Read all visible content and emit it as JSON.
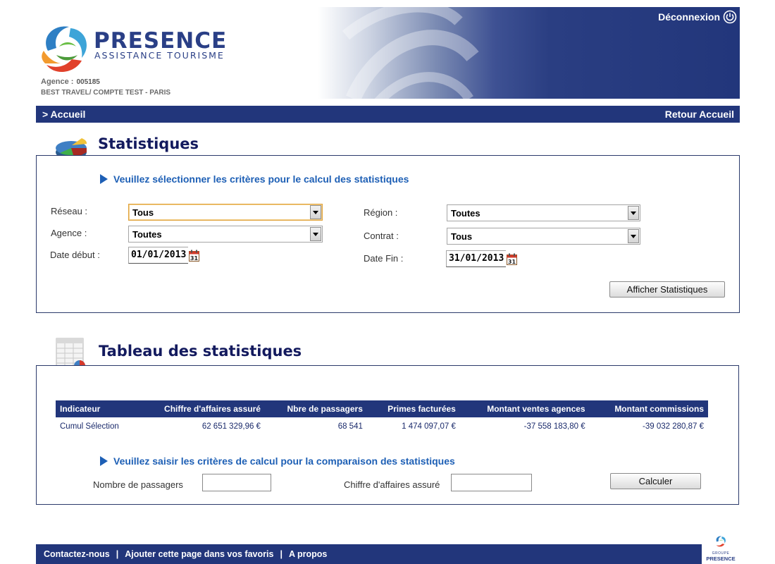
{
  "header": {
    "logo_title": "PRESENCE",
    "logo_subtitle": "ASSISTANCE TOURISME",
    "agency_label": "Agence :",
    "agency_number": "005185",
    "agency_name": "BEST TRAVEL/ COMPTE TEST - PARIS",
    "logout_label": "Déconnexion"
  },
  "nav": {
    "home": "> Accueil",
    "return_home": "Retour Accueil"
  },
  "statistics": {
    "title": "Statistiques",
    "instruction": "Veuillez sélectionner les critères pour le calcul des statistiques",
    "fields": {
      "reseau": {
        "label": "Réseau :",
        "value": "Tous"
      },
      "agence": {
        "label": "Agence :",
        "value": "Toutes"
      },
      "date_debut": {
        "label": "Date début :",
        "value": "01/01/2013"
      },
      "region": {
        "label": "Région :",
        "value": "Toutes"
      },
      "contrat": {
        "label": "Contrat :",
        "value": "Tous"
      },
      "date_fin": {
        "label": "Date Fin :",
        "value": "31/01/2013"
      }
    },
    "calendar_day": "31",
    "submit_label": "Afficher Statistiques"
  },
  "table_section": {
    "title": "Tableau des statistiques",
    "columns": [
      "Indicateur",
      "Chiffre d'affaires assuré",
      "Nbre de passagers",
      "Primes facturées",
      "Montant ventes agences",
      "Montant commissions"
    ],
    "row": [
      "Cumul Sélection",
      "62 651 329,96 €",
      "68 541",
      "1 474 097,07 €",
      "-37 558 183,80 €",
      "-39 032 280,87 €"
    ],
    "comparison_instruction": "Veuillez saisir les critères de calcul pour la comparaison des statistiques",
    "passengers_label": "Nombre de passagers",
    "passengers_value": "",
    "revenue_label": "Chiffre d'affaires assuré",
    "revenue_value": "",
    "calculate_label": "Calculer"
  },
  "footer": {
    "contact": "Contactez-nous",
    "favorites": "Ajouter cette page dans vos favoris",
    "about": "A propos",
    "separator": "|",
    "logo_small": "GROUPE",
    "logo_big": "PRESENCE"
  },
  "colors": {
    "navy": "#22367b",
    "title_blue": "#131a5e",
    "instruction_blue": "#1d5fb5"
  }
}
